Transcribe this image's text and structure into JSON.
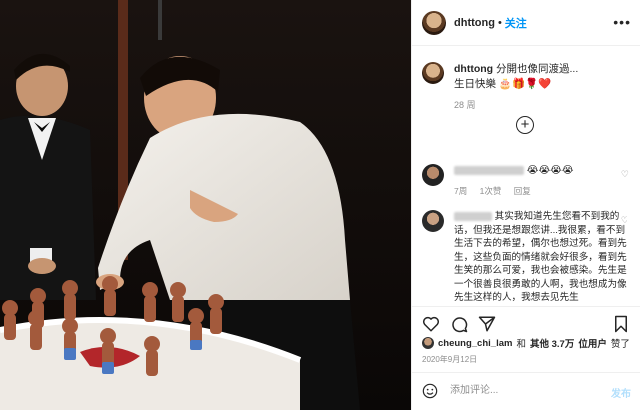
{
  "post": {
    "username": "dhttong",
    "follow_label": "关注",
    "more_label": "•••",
    "caption_text": "分開也像同渡過...",
    "caption_line2": "生日快樂",
    "caption_emojis": "🎂🎁🌹❤️",
    "caption_age": "28 周"
  },
  "comments": [
    {
      "emojis": "😭😭😭😭",
      "age": "7周",
      "likes": "1次赞",
      "reply": "回复"
    },
    {
      "text": "其实我知道先生您看不到我的话，但我还是想跟您讲...我很累，看不到生活下去的希望，偶尔也想过死。看到先生，这些负面的情绪就会好很多，看到先生笑的那么可爱，我也会被感染。先生是一个很善良很勇敢的人啊，我也想成为像先生这样的人，我想去见先生"
    }
  ],
  "likes_line": {
    "user": "cheung_chi_lam",
    "and": "和",
    "others": "其他 3.7万",
    "users_label": "位用户",
    "liked": "赞了"
  },
  "post_date": "2020年9月12日",
  "add_comment": {
    "placeholder": "添加评论...",
    "post_label": "发布"
  },
  "icons": [
    "heart-icon",
    "comment-icon",
    "share-icon",
    "bookmark-icon",
    "emoji-icon",
    "plus-circle-icon"
  ],
  "colors": {
    "accent": "#0095f6",
    "muted": "#8e8e8e",
    "border": "#efefef"
  }
}
